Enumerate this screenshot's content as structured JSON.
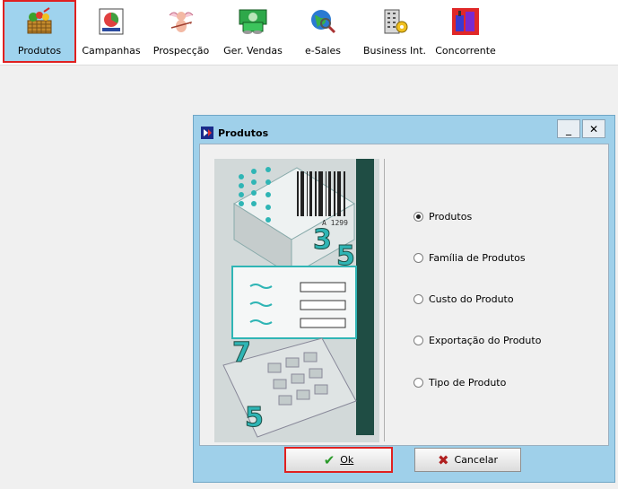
{
  "toolbar": {
    "items": [
      {
        "label": "Produtos",
        "icon": "basket-icon"
      },
      {
        "label": "Campanhas",
        "icon": "campaign-icon"
      },
      {
        "label": "Prospecção",
        "icon": "cupid-icon"
      },
      {
        "label": "Ger. Vendas",
        "icon": "money-icon"
      },
      {
        "label": "e-Sales",
        "icon": "globe-search-icon"
      },
      {
        "label": "Business Int.",
        "icon": "building-gear-icon"
      },
      {
        "label": "Concorrente",
        "icon": "factory-icon"
      }
    ],
    "active": "Produtos"
  },
  "dialog": {
    "title": "Produtos",
    "minimize_symbol": "_",
    "close_symbol": "✕",
    "options": [
      {
        "label": "Produtos",
        "selected": true
      },
      {
        "label": "Família de Produtos",
        "selected": false
      },
      {
        "label": "Custo do Produto",
        "selected": false
      },
      {
        "label": "Exportação do Produto",
        "selected": false
      },
      {
        "label": "Tipo de Produto",
        "selected": false
      }
    ],
    "ok_label": "Ok",
    "cancel_label": "Cancelar",
    "barcode_text": "A 1299",
    "art_digits": [
      "3",
      "5",
      "7",
      "5"
    ]
  },
  "colors": {
    "toolbar_active": "#9fd3ee",
    "highlight": "#e02020",
    "dialog_frame": "#9fd0ea",
    "art_teal": "#2fb5b5",
    "art_dark": "#1f4d44"
  }
}
